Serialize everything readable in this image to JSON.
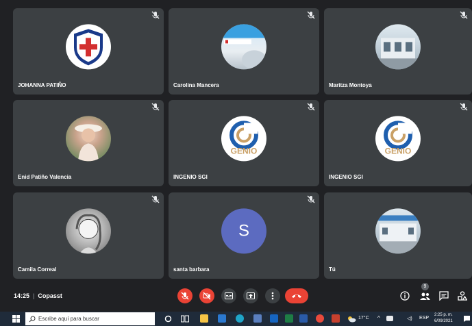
{
  "participants": [
    {
      "name": "JOHANNA PATIÑO"
    },
    {
      "name": "Carolina Mancera"
    },
    {
      "name": "Maritza Montoya"
    },
    {
      "name": "Enid Patiño Valencia"
    },
    {
      "name": "INGENIO SGI",
      "logo_text": "GENIO"
    },
    {
      "name": "INGENIO SGI",
      "logo_text": "GENIO"
    },
    {
      "name": "Camila Correal"
    },
    {
      "name": "santa barbara",
      "initial": "S"
    },
    {
      "name": "Tú"
    }
  ],
  "meeting": {
    "time": "14:25",
    "title": "Copasst",
    "participant_count": "9"
  },
  "taskbar": {
    "search_placeholder": "Escribe aquí para buscar",
    "weather": "17°C",
    "language": "ESP",
    "clock_time": "2:25 p. m.",
    "clock_date": "6/09/2021"
  },
  "colors": {
    "tile_bg": "#3c4043",
    "app_bg": "#202124",
    "end_call_red": "#ea4335",
    "avatar_s": "#5c6bc0"
  }
}
